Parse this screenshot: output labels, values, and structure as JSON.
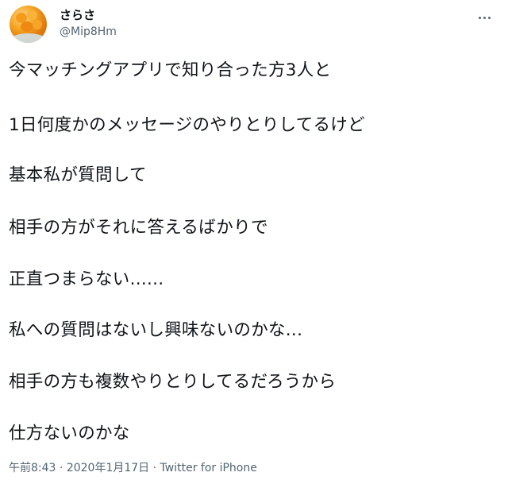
{
  "user": {
    "display_name": "さらさ",
    "handle": "@Mip8Hm",
    "avatar_icon": "avatar-photo"
  },
  "tweet": {
    "lines": [
      "今マッチングアプリで知り合った方3人と",
      "1日何度かのメッセージのやりとりしてるけど",
      "基本私が質問して",
      "相手の方がそれに答えるばかりで",
      "正直つまらない......",
      "私への質問はないし興味ないのかな...",
      "相手の方も複数やりとりしてるだろうから",
      "仕方ないのかな"
    ]
  },
  "meta": {
    "time": "午前8:43",
    "separator": " · ",
    "date": "2020年1月17日",
    "source": "Twitter for iPhone"
  },
  "icons": {
    "more": "more-horizontal-icon"
  }
}
